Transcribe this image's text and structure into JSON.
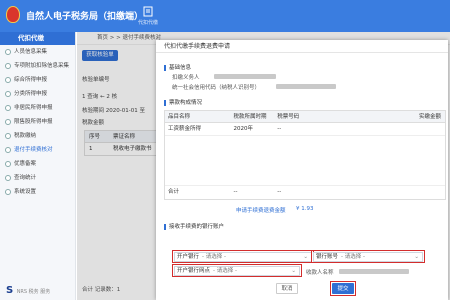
{
  "app": {
    "title": "自然人电子税务局（扣缴端）",
    "toolbar_label": "代扣代缴"
  },
  "sidebar": {
    "header": "代扣代缴",
    "items": [
      {
        "label": "人员信息采集"
      },
      {
        "label": "专项附加扣除信息采集"
      },
      {
        "label": "综合所得申报"
      },
      {
        "label": "分类所得申报"
      },
      {
        "label": "非居民所得申报"
      },
      {
        "label": "限售股所得申报"
      },
      {
        "label": "税款缴纳"
      },
      {
        "label": "退付手续费核对"
      },
      {
        "label": "优惠备案"
      },
      {
        "label": "查询统计"
      },
      {
        "label": "系统设置"
      }
    ],
    "footer_logo": "S",
    "footer_text": "NRS  税务  服务"
  },
  "main": {
    "breadcrumb": "首页 > > 退付手续费核对",
    "get_button": "获取核验单",
    "report_no_label": "核验单编号",
    "tab_label": "1 查询  ←  2 核",
    "period_label": "核验期间",
    "period_value": "2020-01-01 至",
    "tax_total_label": "税款金额",
    "grid_headers": [
      "序号",
      "票证名称"
    ],
    "grid_rows": [
      [
        "1",
        "税收电子缴款书"
      ]
    ],
    "pager": "合计   记录数：1"
  },
  "dialog": {
    "title": "代扣代缴手续费退费申请",
    "basic_section": "基础信息",
    "withholder_label": "扣缴义务人",
    "credit_code_label": "统一社会信用代码（纳税人识别号）",
    "ticket_section": "票款构成情况",
    "table_headers": [
      "品目名称",
      "税款所属时期",
      "税票号码",
      "实缴金额"
    ],
    "table_rows": [
      [
        "工资薪金所得",
        "2020年",
        "--",
        ""
      ]
    ],
    "total_label": "合计",
    "total_cells": [
      "--",
      "--"
    ],
    "apply_amount_label": "申请手续费退费金额",
    "apply_amount_value": "¥ 1.93",
    "bank_section": "接收手续费的银行账户",
    "bank_open_label": "开户银行",
    "bank_open_placeholder": "- 请选择 -",
    "bank_branch_label": "开户银行网点",
    "bank_branch_placeholder": "- 请选择 -",
    "account_label": "银行账号",
    "account_placeholder": "- 请选择 -",
    "payee_label": "收款人名称",
    "cancel_button": "取消",
    "submit_button": "提交"
  },
  "colors": {
    "primary": "#2f6fd4",
    "highlight": "#d32d2d"
  }
}
